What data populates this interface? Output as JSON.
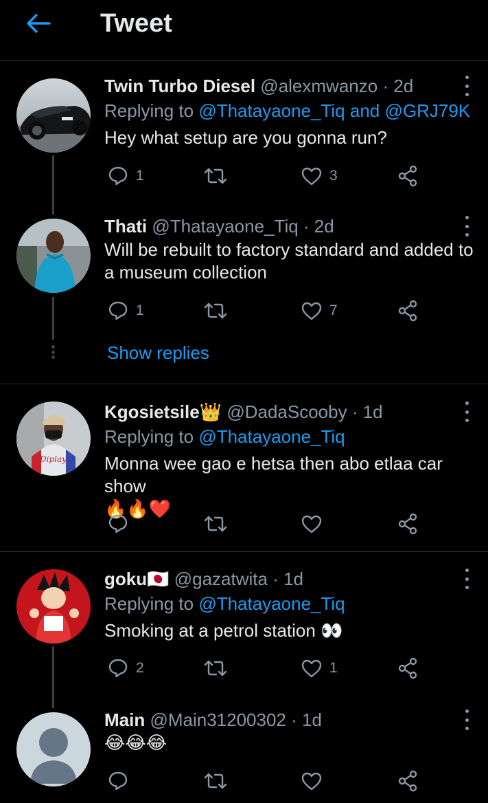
{
  "header": {
    "title": "Tweet"
  },
  "tweets": [
    {
      "name": "Twin Turbo Diesel",
      "handle": "@alexmwanzo",
      "time": "· 2d",
      "replying_prefix": "Replying to",
      "replying_to": "@Thatayaone_Tiq and @GRJ79K",
      "text": "Hey what setup are you gonna run?",
      "reply_count": "1",
      "retweet_count": "",
      "like_count": "3"
    },
    {
      "name": "Thati",
      "handle": "@Thatayaone_Tiq",
      "time": "· 2d",
      "text": "Will be rebuilt to factory standard and added to a museum collection",
      "reply_count": "1",
      "retweet_count": "",
      "like_count": "7"
    },
    {
      "name": "Kgosietsile",
      "name_emoji": "👑",
      "handle": "@DadaScooby",
      "time": "· 1d",
      "replying_prefix": "Replying to",
      "replying_to": "@Thatayaone_Tiq",
      "text": "Monna wee gao e hetsa then abo etlaa car show",
      "text_emoji": "🔥🔥❤️",
      "reply_count": "",
      "retweet_count": "",
      "like_count": ""
    },
    {
      "name": "goku",
      "name_emoji": "🇯🇵",
      "handle": "@gazatwita",
      "time": "· 1d",
      "replying_prefix": "Replying to",
      "replying_to": "@Thatayaone_Tiq",
      "text": "Smoking at a petrol station",
      "text_emoji": "👀",
      "reply_count": "2",
      "retweet_count": "",
      "like_count": "1"
    },
    {
      "name": "Main",
      "handle": "@Main31200302",
      "time": "· 1d",
      "text_emoji": "😂😂😂",
      "reply_count": "",
      "retweet_count": "",
      "like_count": ""
    }
  ],
  "show_replies": "Show replies",
  "icons": {
    "back": "arrow-left-icon",
    "reply": "reply-icon",
    "retweet": "retweet-icon",
    "like": "heart-icon",
    "share": "share-icon",
    "more": "more-vertical-icon"
  },
  "colors": {
    "accent": "#1d9bf0",
    "background": "#000000",
    "secondary_text": "#8b98a5"
  }
}
